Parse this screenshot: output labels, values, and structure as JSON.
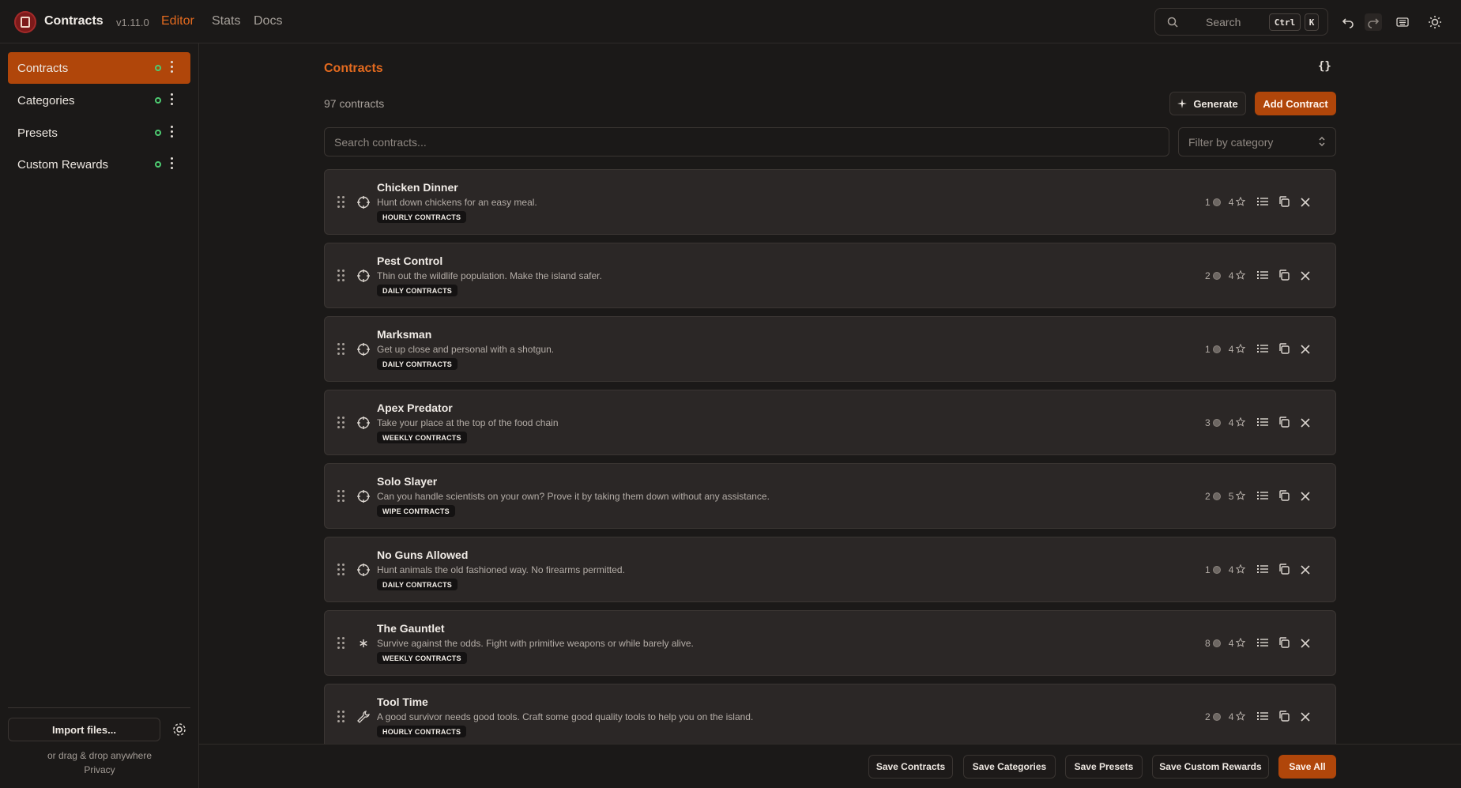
{
  "app": {
    "title": "Contracts",
    "version": "v1.11.0"
  },
  "nav": {
    "editor": "Editor",
    "stats": "Stats",
    "docs": "Docs"
  },
  "search": {
    "placeholder": "Search",
    "kbd_ctrl": "Ctrl",
    "kbd_k": "K"
  },
  "sidebar": {
    "items": [
      {
        "label": "Contracts",
        "active": true
      },
      {
        "label": "Categories",
        "active": false
      },
      {
        "label": "Presets",
        "active": false
      },
      {
        "label": "Custom Rewards",
        "active": false
      }
    ],
    "import_label": "Import files...",
    "drag_text": "or drag & drop anywhere",
    "privacy": "Privacy"
  },
  "main": {
    "title": "Contracts",
    "json_toggle": "{}",
    "count": "97 contracts",
    "generate_label": "Generate",
    "add_label": "Add Contract",
    "search_placeholder": "Search contracts...",
    "filter_placeholder": "Filter by category"
  },
  "contracts": [
    {
      "name": "Chicken Dinner",
      "desc": "Hunt down chickens for an easy meal.",
      "badge": "HOURLY CONTRACTS",
      "coins": "1",
      "stars": "4",
      "icon": "crosshair-icon"
    },
    {
      "name": "Pest Control",
      "desc": "Thin out the wildlife population. Make the island safer.",
      "badge": "DAILY CONTRACTS",
      "coins": "2",
      "stars": "4",
      "icon": "crosshair-icon"
    },
    {
      "name": "Marksman",
      "desc": "Get up close and personal with a shotgun.",
      "badge": "DAILY CONTRACTS",
      "coins": "1",
      "stars": "4",
      "icon": "crosshair-icon"
    },
    {
      "name": "Apex Predator",
      "desc": "Take your place at the top of the food chain",
      "badge": "WEEKLY CONTRACTS",
      "coins": "3",
      "stars": "4",
      "icon": "crosshair-icon"
    },
    {
      "name": "Solo Slayer",
      "desc": "Can you handle scientists on your own? Prove it by taking them down without any assistance.",
      "badge": "WIPE CONTRACTS",
      "coins": "2",
      "stars": "5",
      "icon": "crosshair-icon"
    },
    {
      "name": "No Guns Allowed",
      "desc": "Hunt animals the old fashioned way. No firearms permitted.",
      "badge": "DAILY CONTRACTS",
      "coins": "1",
      "stars": "4",
      "icon": "crosshair-icon"
    },
    {
      "name": "The Gauntlet",
      "desc": "Survive against the odds. Fight with primitive weapons or while barely alive.",
      "badge": "WEEKLY CONTRACTS",
      "coins": "8",
      "stars": "4",
      "icon": "asterisk-icon"
    },
    {
      "name": "Tool Time",
      "desc": "A good survivor needs good tools. Craft some good quality tools to help you on the island.",
      "badge": "HOURLY CONTRACTS",
      "coins": "2",
      "stars": "4",
      "icon": "wrench-icon"
    }
  ],
  "bottom": {
    "save_contracts": "Save Contracts",
    "save_categories": "Save Categories",
    "save_presets": "Save Presets",
    "save_custom_rewards": "Save Custom Rewards",
    "save_all": "Save All"
  },
  "colors": {
    "accent": "#b0460a",
    "accent_text": "#e36a1f",
    "status_dot": "#4ecb71",
    "card_bg": "#2b2726",
    "page_bg": "#1b1918"
  }
}
